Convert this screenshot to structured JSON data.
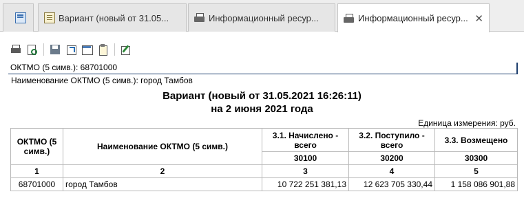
{
  "tabs": [
    {
      "label": "",
      "icon": "home-icon"
    },
    {
      "label": "Вариант (новый от 31.05...",
      "icon": "document-icon"
    },
    {
      "label": "Информационный ресур...",
      "icon": "printer-icon"
    },
    {
      "label": "Информационный ресур...",
      "icon": "printer-icon",
      "active": true
    }
  ],
  "toolbar": {
    "buttons": [
      "print-icon",
      "preview-icon",
      "save-icon",
      "export-icon",
      "table-icon",
      "clipboard-icon",
      "edit-icon"
    ]
  },
  "filters": {
    "oktmo": "ОКТМО (5 симв.): 68701000",
    "name": "Наименование ОКТМО (5 симв.): город Тамбов"
  },
  "report": {
    "title_line1": "Вариант (новый от 31.05.2021 16:26:11)",
    "title_line2": "на 2 июня 2021 года",
    "units": "Единица измерения: руб.",
    "headers": {
      "col1": "ОКТМО (5 симв.)",
      "col2": "Наименование ОКТМО (5 симв.)",
      "col3": "3.1. Начислено - всего",
      "col4": "3.2. Поступило - всего",
      "col5": "3.3. Возмещено"
    },
    "codes": {
      "col3": "30100",
      "col4": "30200",
      "col5": "30300"
    },
    "numbers": {
      "col1": "1",
      "col2": "2",
      "col3": "3",
      "col4": "4",
      "col5": "5"
    },
    "rows": [
      {
        "oktmo": "68701000",
        "name": "город Тамбов",
        "accrued": "10 722 251 381,13",
        "received": "12 623 705 330,44",
        "refunded": "1 158 086 901,88"
      }
    ]
  }
}
